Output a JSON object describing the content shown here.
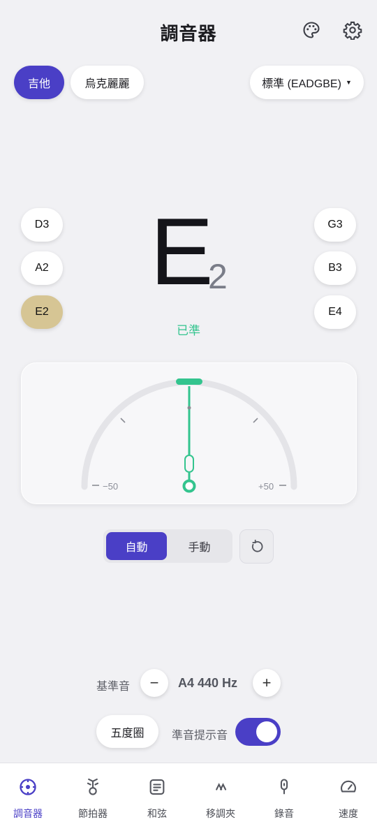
{
  "header": {
    "title": "調音器",
    "palette_icon": "palette-icon",
    "settings_icon": "gear-icon"
  },
  "instruments": {
    "guitar": "吉他",
    "ukulele": "烏克麗麗",
    "selected": "guitar"
  },
  "tuning_dropdown": {
    "label": "標準 (EADGBE)",
    "icon": "caret-down-icon"
  },
  "strings": {
    "left": [
      "D3",
      "A2",
      "E2"
    ],
    "right": [
      "G3",
      "B3",
      "E4"
    ],
    "selected": "E2"
  },
  "note": {
    "letter": "E",
    "octave": "2",
    "status": "已準"
  },
  "gauge": {
    "min_label": "−50",
    "max_label": "+50",
    "cents_value": "0",
    "range": [
      -50,
      50
    ],
    "needle_cents": 0
  },
  "mode": {
    "auto": "自動",
    "manual": "手動",
    "selected": "auto",
    "reset_icon": "reset-icon"
  },
  "reference": {
    "label": "基準音",
    "value": "A4 440 Hz",
    "decrease": "−",
    "increase": "+"
  },
  "circle_of_fifths": "五度圈",
  "reference_tone": {
    "label": "準音提示音",
    "enabled": true
  },
  "nav": [
    {
      "label": "調音器",
      "icon": "tuner-icon",
      "active": true
    },
    {
      "label": "節拍器",
      "icon": "metronome-icon",
      "active": false
    },
    {
      "label": "和弦",
      "icon": "chord-icon",
      "active": false
    },
    {
      "label": "移調夾",
      "icon": "capo-icon",
      "active": false
    },
    {
      "label": "錄音",
      "icon": "mic-icon",
      "active": false
    },
    {
      "label": "速度",
      "icon": "speed-icon",
      "active": false
    }
  ],
  "colors": {
    "accent": "#4a3fc6",
    "in_tune": "#33c48e",
    "selected_string": "#d6c594"
  }
}
